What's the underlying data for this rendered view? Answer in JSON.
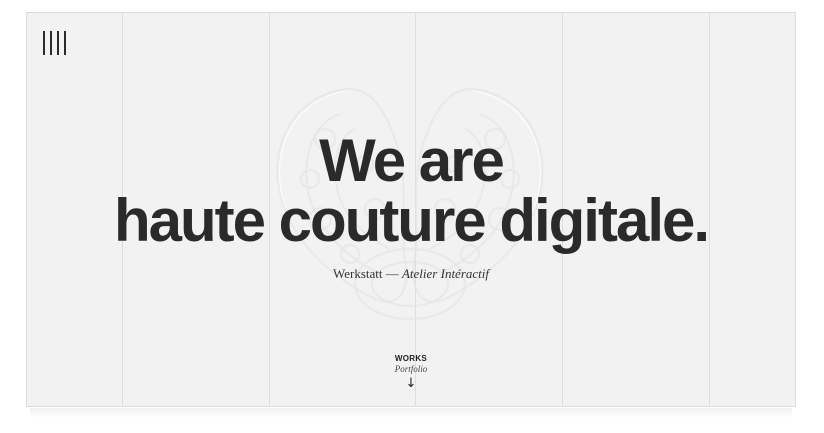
{
  "menu": {
    "icon": "menu-lines-icon"
  },
  "hero": {
    "line1": "We are",
    "line2": "haute couture digitale.",
    "tagline_name": "Werkstatt",
    "tagline_dash": " — ",
    "tagline_sub": "Atelier Intéractif"
  },
  "scroll_cta": {
    "title": "WORKS",
    "subtitle": "Portfolio",
    "arrow": "↓",
    "icon": "arrow-down-icon"
  },
  "colors": {
    "background": "#f2f2f2",
    "text": "#2a2a2a",
    "grid": "#dedede"
  }
}
